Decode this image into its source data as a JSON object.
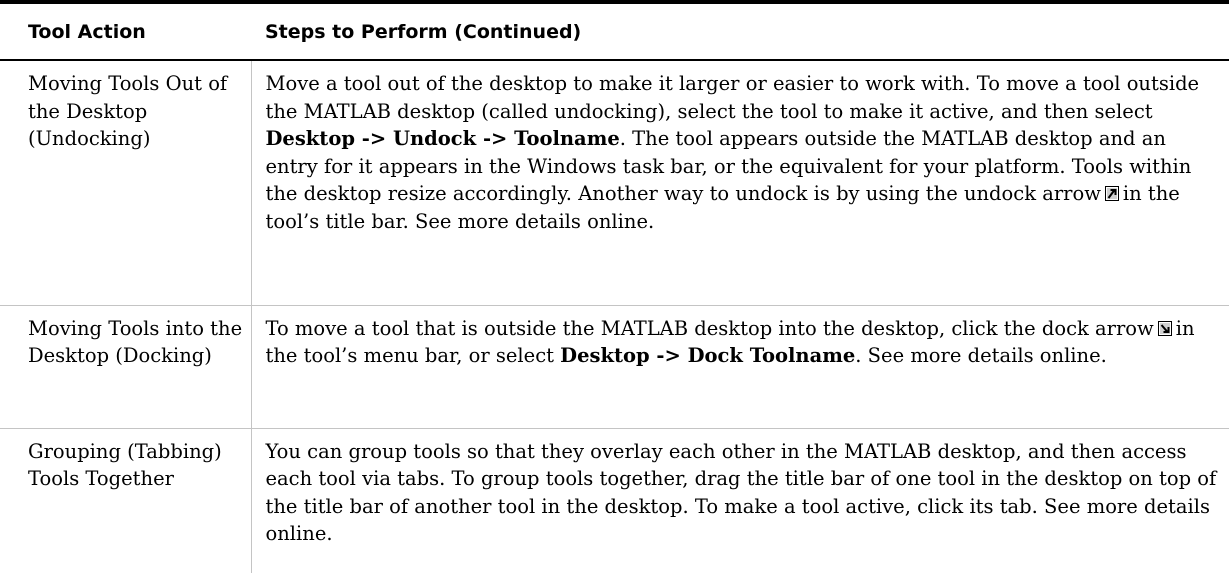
{
  "table": {
    "headers": {
      "action": "Tool Action",
      "steps": "Steps to Perform (Continued)"
    },
    "rows": [
      {
        "action": "Moving Tools Out of the Desktop (Undocking)",
        "steps": {
          "t1": "Move a tool out of the desktop to make it larger or easier to work with. To move a tool outside the MATLAB desktop (called undocking), select the tool to make it active, and then select ",
          "b1": "Desktop -> Undock -> Toolname",
          "t2": ". The tool appears outside the MATLAB desktop and an entry for it appears in the Windows task bar, or the equivalent for your platform. Tools within the desktop resize accordingly. Another way to undock is by using the undock arrow",
          "icon": "undock-arrow-icon",
          "t3": "in the tool’s title bar. See more details online."
        }
      },
      {
        "action": "Moving Tools into the Desktop (Docking)",
        "steps": {
          "t1": "To move a tool that is outside the MATLAB desktop into the desktop, click the dock arrow",
          "icon": "dock-arrow-icon",
          "t2": "in the tool’s menu bar, or select ",
          "b1": "Desktop -> Dock Toolname",
          "t3": ". See more details online."
        }
      },
      {
        "action": "Grouping (Tabbing) Tools Together",
        "steps": {
          "t1": "You can group tools so that they overlay each other in the MATLAB desktop, and then access each tool via tabs. To group tools together, drag the title bar of one tool in the desktop on top of the title bar of another tool in the desktop. To make a tool active, click its tab. See more details online."
        }
      }
    ]
  }
}
